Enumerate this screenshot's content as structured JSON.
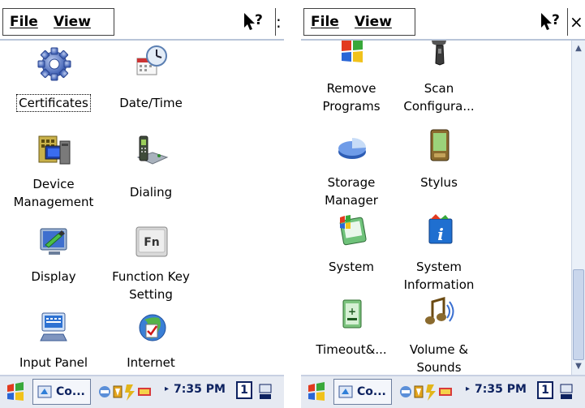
{
  "screens": [
    {
      "menu": {
        "file": "File",
        "view": "View"
      },
      "items": [
        {
          "label": "Certificates",
          "icon": "certificates-gear-icon"
        },
        {
          "label": "Date/Time",
          "icon": "clock-calendar-icon"
        },
        {
          "label": "Device\nManagement",
          "icon": "device-management-icon"
        },
        {
          "label": "Dialing",
          "icon": "phone-dialing-icon"
        },
        {
          "label": "Display",
          "icon": "display-monitor-icon"
        },
        {
          "label": "Function Key\nSetting",
          "icon": "fn-key-icon",
          "text": "Fn"
        },
        {
          "label": "Input Panel",
          "icon": "keyboard-input-icon"
        },
        {
          "label": "Internet\nOptions",
          "icon": "globe-check-icon"
        }
      ],
      "taskbar": {
        "task_label": "Co...",
        "time": "7:35 PM",
        "desktop_num": "1"
      }
    },
    {
      "menu": {
        "file": "File",
        "view": "View"
      },
      "items": [
        {
          "label": "Remove\nPrograms",
          "icon": "remove-programs-icon"
        },
        {
          "label": "Scan\nConfigura...",
          "icon": "scanner-icon"
        },
        {
          "label": "Storage\nManager",
          "icon": "pie-storage-icon"
        },
        {
          "label": "Stylus",
          "icon": "stylus-pda-icon"
        },
        {
          "label": "System",
          "icon": "system-flag-icon"
        },
        {
          "label": "System\nInformation",
          "icon": "info-icon"
        },
        {
          "label": "Timeout&...",
          "icon": "battery-timeout-icon"
        },
        {
          "label": "Volume &\nSounds",
          "icon": "music-note-icon"
        }
      ],
      "taskbar": {
        "task_label": "Co...",
        "time": "7:35 PM",
        "desktop_num": "1"
      }
    }
  ]
}
